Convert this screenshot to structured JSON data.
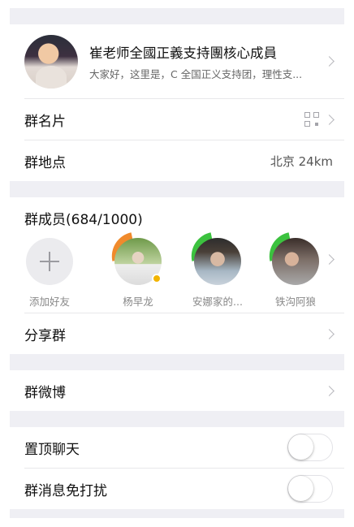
{
  "header": {
    "group_name": "崔老师全國正義支持團核心成員",
    "group_desc": "大家好，这里是，C 全国正义支持团，理性支..."
  },
  "group_card": {
    "label": "群名片",
    "icon": "qr-code-icon"
  },
  "group_location": {
    "label": "群地点",
    "value": "北京 24km"
  },
  "members": {
    "title": "群成员(684/1000)",
    "add_label": "添加好友",
    "list": [
      {
        "name": "杨早龙",
        "ribbon_color": "#f08a2c",
        "badge": true
      },
      {
        "name": "安娜家的...",
        "ribbon_color": "#3cc23f",
        "badge": false
      },
      {
        "name": "铁沟阿狼",
        "ribbon_color": "#3cc23f",
        "badge": false
      }
    ]
  },
  "share_group": {
    "label": "分享群"
  },
  "group_weibo": {
    "label": "群微博"
  },
  "pin_chat": {
    "label": "置顶聊天",
    "on": false
  },
  "mute": {
    "label": "群消息免打扰",
    "on": false
  },
  "colors": {
    "background": "#efeff4",
    "divider": "#e8e8ea",
    "text": "#111111",
    "subtext": "#888888"
  }
}
